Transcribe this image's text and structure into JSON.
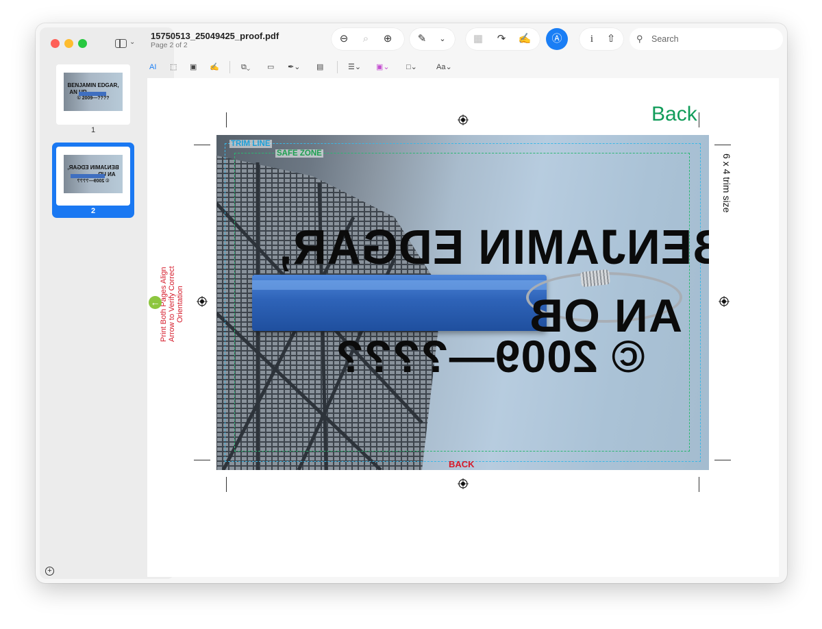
{
  "window": {
    "file_title": "15750513_25049425_proof.pdf",
    "page_indicator": "Page 2 of 2"
  },
  "sidebar": {
    "pages": [
      {
        "number": "1",
        "selected": false
      },
      {
        "number": "2",
        "selected": true
      }
    ],
    "thumb_text": {
      "line1": "BENJAMIN EDGAR,",
      "line2": "AN UR",
      "line3": "© 2009—????"
    }
  },
  "toolbar": {
    "icons": [
      "zoom-out-icon",
      "actual-size-icon",
      "zoom-in-icon",
      "highlight-icon",
      "chevron-down-icon",
      "crop-icon",
      "rotate-icon",
      "signature-icon",
      "markup-icon",
      "info-icon",
      "share-icon"
    ],
    "search_placeholder": "Search"
  },
  "markup_toolbar": {
    "text_selection": "AI",
    "text_style": "Aa"
  },
  "document": {
    "trim_label": "TRIM LINE",
    "safe_label": "SAFE ZONE",
    "mirrored_line1": "BENJAMIN EDGAR,",
    "mirrored_line2": "AN OB",
    "mirrored_line3": "© 2009—????",
    "back_heading": "Back",
    "back_label": "BACK",
    "trim_size": "6 x 4 trim size",
    "print_note": "Print Both Pages Align Arrow to Verify Correct Orientation"
  },
  "colors": {
    "accent": "#1a7ef5",
    "trim_line": "#39b7e6",
    "safe_zone": "#2bb673",
    "back_heading": "#119c5a",
    "back_label": "#d51a2a"
  }
}
